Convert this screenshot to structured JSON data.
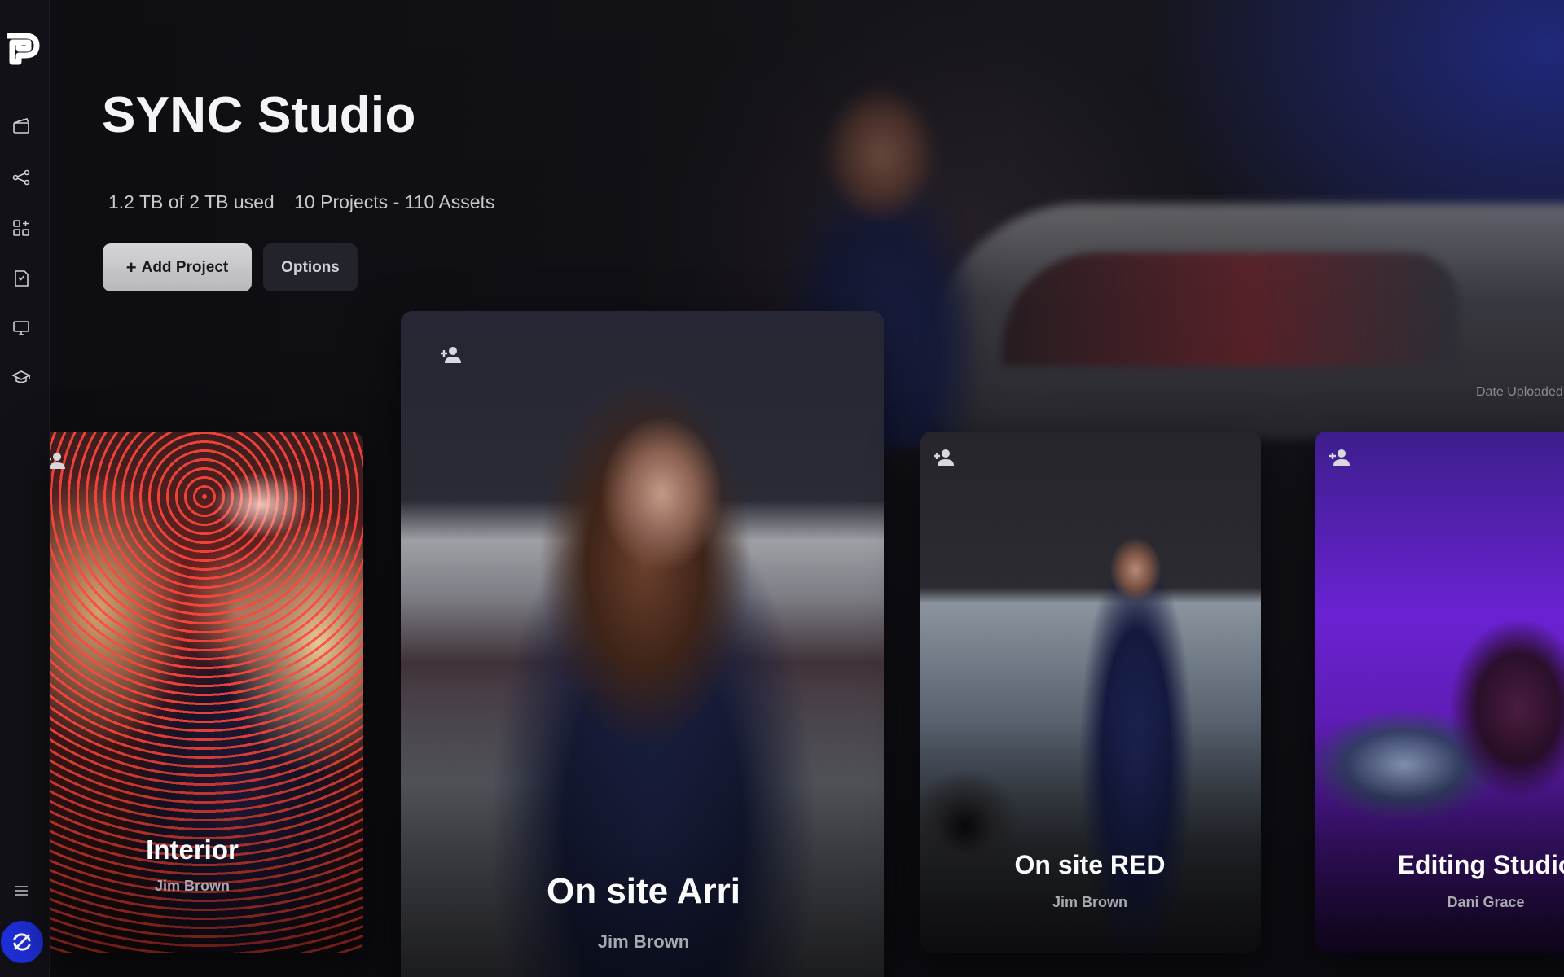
{
  "app": {
    "title": "SYNC Studio"
  },
  "colors": {
    "accent": "#1f2fd8",
    "background": "#0b0b10"
  },
  "sidebar": {
    "logo": "app-logo",
    "items": [
      {
        "name": "projects",
        "icon": "clapperboard-icon"
      },
      {
        "name": "share",
        "icon": "share-nodes-icon"
      },
      {
        "name": "apps",
        "icon": "apps-add-icon"
      },
      {
        "name": "save",
        "icon": "floppy-icon"
      },
      {
        "name": "display",
        "icon": "monitor-icon"
      },
      {
        "name": "learn",
        "icon": "graduation-cap-icon"
      }
    ],
    "bottom": [
      {
        "name": "menu",
        "icon": "menu-lines-icon"
      },
      {
        "name": "account",
        "icon": "sync-avatar-icon"
      }
    ]
  },
  "header": {
    "storage": "1.2 TB of 2 TB used",
    "summary": "10 Projects - 110 Assets",
    "add_project_label": "Add Project",
    "add_project_icon": "plus-icon",
    "options_label": "Options",
    "sort_label": "Date Uploaded"
  },
  "projects": [
    {
      "title": "Interior",
      "owner": "Jim Brown",
      "icon": "add-person-icon"
    },
    {
      "title": "On site Arri",
      "owner": "Jim Brown",
      "icon": "add-person-icon"
    },
    {
      "title": "On site RED",
      "owner": "Jim Brown",
      "icon": "add-person-icon"
    },
    {
      "title": "Editing Studio",
      "owner": "Dani Grace",
      "icon": "add-person-icon"
    }
  ]
}
